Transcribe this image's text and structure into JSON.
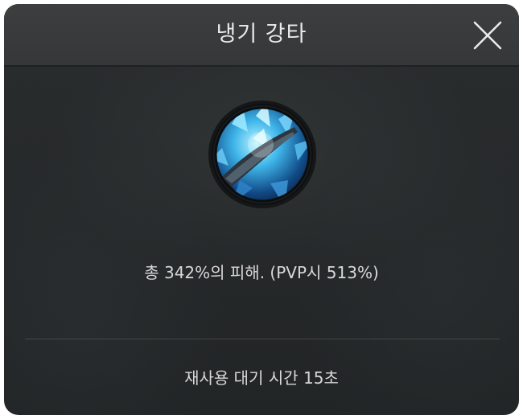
{
  "dialog": {
    "title": "냉기 강타",
    "close_icon": "close-icon",
    "skill_icon": "frost-strike-skill-icon",
    "description": "총 342%의 피해. (PVP시 513%)",
    "cooldown": "재사용 대기 시간 15초"
  },
  "colors": {
    "background": "#262929",
    "header": "#3a3c3d",
    "text": "#d8d8d8",
    "icon_glow": "#3ec8ff"
  }
}
